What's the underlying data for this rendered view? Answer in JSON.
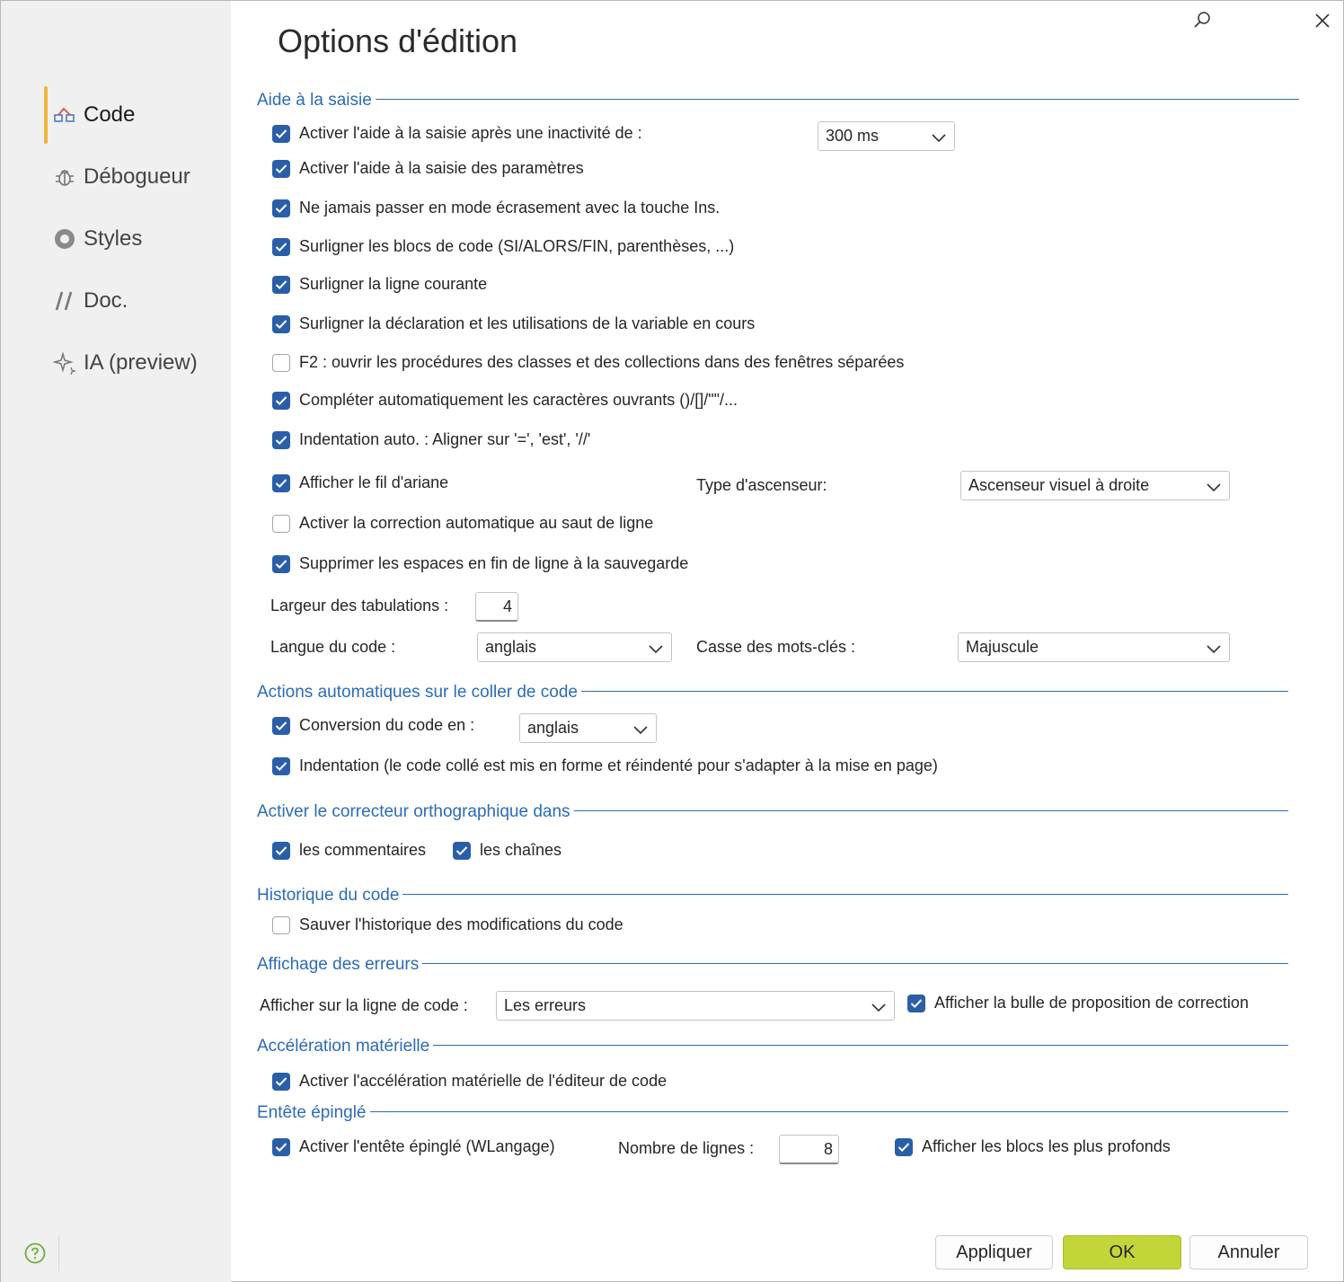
{
  "dialog": {
    "title": "Options d'édition"
  },
  "sidebar": {
    "items": [
      {
        "label": "Code",
        "icon": "code-icon",
        "active": true
      },
      {
        "label": "Débogueur",
        "icon": "bug-icon"
      },
      {
        "label": "Styles",
        "icon": "styles-icon"
      },
      {
        "label": "Doc.",
        "icon": "doc-slashes-icon"
      },
      {
        "label": "IA (preview)",
        "icon": "sparkle-icon"
      }
    ]
  },
  "sections": {
    "aide": "Aide à la saisie",
    "coller": "Actions automatiques sur le coller de code",
    "correcteur": "Activer le correcteur orthographique dans",
    "historique": "Historique du code",
    "erreurs": "Affichage des erreurs",
    "acceleration": "Accélération matérielle",
    "entete": "Entête épinglé"
  },
  "aide": {
    "inactivite": {
      "label": "Activer l'aide à la saisie après une inactivité de :",
      "checked": true,
      "delay": "300 ms"
    },
    "parametres": {
      "label": "Activer l'aide à la saisie des paramètres",
      "checked": true
    },
    "ecrasement": {
      "label": "Ne jamais passer en mode écrasement avec la touche Ins.",
      "checked": true
    },
    "blocs": {
      "label": "Surligner les blocs de code (SI/ALORS/FIN, parenthèses, ...)",
      "checked": true
    },
    "ligne": {
      "label": "Surligner la ligne courante",
      "checked": true
    },
    "declaration": {
      "label": "Surligner la déclaration et les utilisations de la variable en cours",
      "checked": true
    },
    "f2": {
      "label": "F2 : ouvrir les procédures des classes et des collections dans des fenêtres séparées",
      "checked": false
    },
    "completer": {
      "label": "Compléter automatiquement les caractères ouvrants ()/[]/\"\"/...",
      "checked": true
    },
    "indentation": {
      "label": "Indentation auto. : Aligner sur '=', 'est', '//'",
      "checked": true
    },
    "ariane": {
      "label": "Afficher le fil d'ariane",
      "checked": true
    },
    "ascenseur_label": "Type d'ascenseur:",
    "ascenseur_value": "Ascenseur visuel à droite",
    "correction": {
      "label": "Activer la correction automatique au saut de ligne",
      "checked": false
    },
    "espaces": {
      "label": "Supprimer les espaces en fin de ligne à la sauvegarde",
      "checked": true
    },
    "tab_label": "Largeur des tabulations :",
    "tab_value": "4",
    "langue_label": "Langue du code :",
    "langue_value": "anglais",
    "casse_label": "Casse des mots-clés :",
    "casse_value": "Majuscule"
  },
  "coller": {
    "conversion": {
      "label": "Conversion du code en :",
      "checked": true,
      "value": "anglais"
    },
    "indentation": {
      "label": "Indentation (le code collé est mis en forme et réindenté pour s'adapter à la mise en page)",
      "checked": true
    }
  },
  "correcteur": {
    "commentaires": {
      "label": "les commentaires",
      "checked": true
    },
    "chaines": {
      "label": "les chaînes",
      "checked": true
    }
  },
  "historique": {
    "sauver": {
      "label": "Sauver l'historique des modifications du code",
      "checked": false
    }
  },
  "erreurs": {
    "afficher_label": "Afficher sur la ligne de code :",
    "afficher_value": "Les erreurs",
    "bulle": {
      "label": "Afficher la bulle de proposition de correction",
      "checked": true
    }
  },
  "acceleration": {
    "activer": {
      "label": "Activer l'accélération matérielle de l'éditeur de code",
      "checked": true
    }
  },
  "entete": {
    "activer": {
      "label": "Activer l'entête épinglé (WLangage)",
      "checked": true
    },
    "nombre_label": "Nombre de lignes :",
    "nombre_value": "8",
    "profonds": {
      "label": "Afficher les blocs les plus profonds",
      "checked": true
    }
  },
  "buttons": {
    "apply": "Appliquer",
    "ok": "OK",
    "cancel": "Annuler"
  },
  "colors": {
    "accent": "#2b6cb3",
    "checkbox": "#2a5fa8",
    "ok_button": "#c2d63a",
    "active_bar": "#f0b63c",
    "sidebar": "#f0f0f0"
  }
}
